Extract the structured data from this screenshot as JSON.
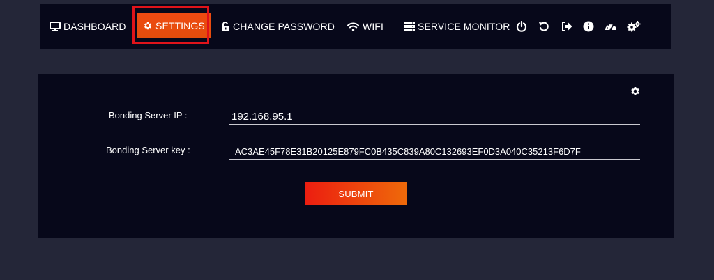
{
  "nav": {
    "dashboard": {
      "label": "DASHBOARD",
      "icon": "monitor-icon"
    },
    "settings": {
      "label": "SETTINGS",
      "icon": "gear-icon"
    },
    "change_password": {
      "label": "CHANGE PASSWORD",
      "icon": "unlock-icon"
    },
    "wifi": {
      "label": "WIFI",
      "icon": "wifi-icon"
    },
    "service_monitor": {
      "label": "SERVICE MONITOR",
      "icon": "server-icon"
    },
    "icons": [
      "power-icon",
      "restart-icon",
      "logout-icon",
      "info-icon",
      "speedometer-icon",
      "cogs-icon"
    ]
  },
  "form": {
    "server_ip_label": "Bonding Server IP :",
    "server_ip_value": "192.168.95.1",
    "server_key_label": "Bonding Server key :",
    "server_key_value": "AC3AE45F78E31B20125E879FC0B435C839A80C132693EF0D3A040C35213F6D7F",
    "submit_label": "SUBMIT",
    "panel_icon": "gear-icon"
  },
  "colors": {
    "page_background": "#242638",
    "panel_background": "#07081a",
    "accent": "#ee4a12",
    "highlight_outline": "#e0131a",
    "button_gradient_start": "#ec1d10",
    "button_gradient_end": "#ee6a0a"
  }
}
